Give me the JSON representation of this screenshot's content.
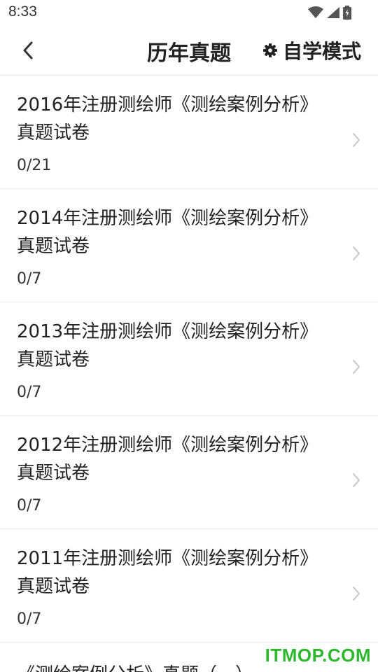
{
  "status_bar": {
    "time": "8:33",
    "icons": [
      "wifi-icon",
      "signal-icon",
      "battery-icon"
    ]
  },
  "header": {
    "back_icon": "chevron-left-icon",
    "title": "历年真题",
    "mode_icon": "gear-icon",
    "mode_label": "自学模式"
  },
  "papers": [
    {
      "title": "2016年注册测绘师《测绘案例分析》真题试卷",
      "progress": "0/21"
    },
    {
      "title": "2014年注册测绘师《测绘案例分析》真题试卷",
      "progress": "0/7"
    },
    {
      "title": "2013年注册测绘师《测绘案例分析》真题试卷",
      "progress": "0/7"
    },
    {
      "title": "2012年注册测绘师《测绘案例分析》真题试卷",
      "progress": "0/7"
    },
    {
      "title": "2011年注册测绘师《测绘案例分析》真题试卷",
      "progress": "0/7"
    }
  ],
  "partial_paper": {
    "title": "《测绘案例分析》真题（一）"
  },
  "watermark": "ITMOP.COM",
  "colors": {
    "watermark": "#2eb82e",
    "divider": "#ececec",
    "chevron": "#c8c8c8"
  }
}
